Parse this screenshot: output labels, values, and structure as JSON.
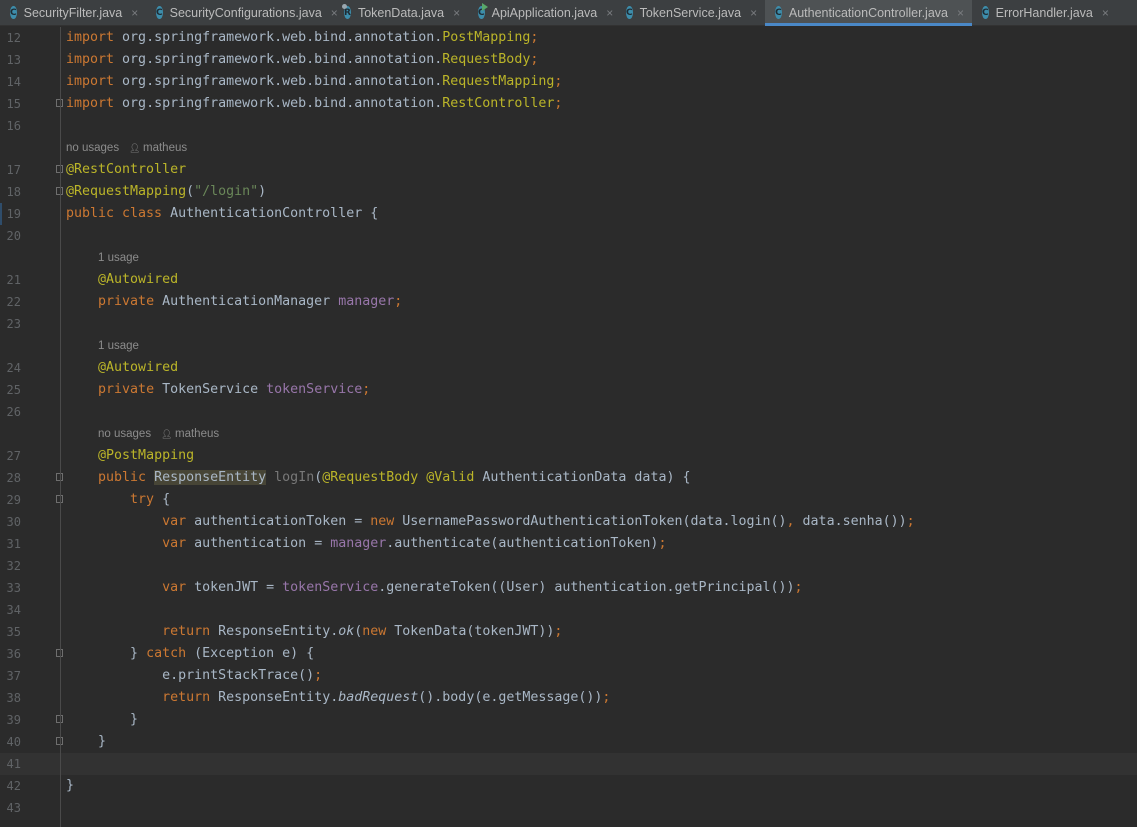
{
  "tabs": [
    {
      "label": "SecurityFilter.java",
      "icon": "class-icon",
      "glyph": "C",
      "active": false
    },
    {
      "label": "SecurityConfigurations.java",
      "icon": "class-icon",
      "glyph": "C",
      "active": false
    },
    {
      "label": "TokenData.java",
      "icon": "record-icon",
      "glyph": "R",
      "active": false
    },
    {
      "label": "ApiApplication.java",
      "icon": "runnable-class-icon",
      "glyph": "C",
      "active": false
    },
    {
      "label": "TokenService.java",
      "icon": "class-icon",
      "glyph": "C",
      "active": false
    },
    {
      "label": "AuthenticationController.java",
      "icon": "class-icon",
      "glyph": "C",
      "active": true
    },
    {
      "label": "ErrorHandler.java",
      "icon": "class-icon",
      "glyph": "C",
      "active": false
    }
  ],
  "close_glyph": "×",
  "colors": {
    "keyword": "#cc7832",
    "annotation": "#bbb529",
    "string": "#6a8759",
    "text": "#a9b7c6",
    "field": "#9876aa",
    "active_tab_underline": "#4a88c7"
  },
  "lines": [
    {
      "n": "12",
      "tokens": [
        [
          "k",
          "import "
        ],
        [
          "t",
          "org.springframework.web.bind.annotation."
        ],
        [
          "a",
          "PostMapping"
        ],
        [
          "k",
          ";"
        ]
      ]
    },
    {
      "n": "13",
      "tokens": [
        [
          "k",
          "import "
        ],
        [
          "t",
          "org.springframework.web.bind.annotation."
        ],
        [
          "a",
          "RequestBody"
        ],
        [
          "k",
          ";"
        ]
      ]
    },
    {
      "n": "14",
      "tokens": [
        [
          "k",
          "import "
        ],
        [
          "t",
          "org.springframework.web.bind.annotation."
        ],
        [
          "a",
          "RequestMapping"
        ],
        [
          "k",
          ";"
        ]
      ]
    },
    {
      "n": "15",
      "fold": true,
      "tokens": [
        [
          "k",
          "import "
        ],
        [
          "t",
          "org.springframework.web.bind.annotation."
        ],
        [
          "a",
          "RestController"
        ],
        [
          "k",
          ";"
        ]
      ]
    },
    {
      "n": "16",
      "tokens": []
    },
    {
      "hint": "no usages",
      "user": "matheus",
      "level": 0
    },
    {
      "n": "17",
      "fold": true,
      "tokens": [
        [
          "a",
          "@RestController"
        ]
      ]
    },
    {
      "n": "18",
      "fold": true,
      "tokens": [
        [
          "a",
          "@RequestMapping"
        ],
        [
          "t",
          "("
        ],
        [
          "s",
          "\"/login\""
        ],
        [
          "t",
          ")"
        ]
      ]
    },
    {
      "n": "19",
      "mark": true,
      "tokens": [
        [
          "k",
          "public class "
        ],
        [
          "t",
          "AuthenticationController {"
        ]
      ]
    },
    {
      "n": "20",
      "tokens": []
    },
    {
      "hint": "1 usage",
      "level": 1
    },
    {
      "n": "21",
      "tokens": [
        [
          "t",
          "    "
        ],
        [
          "a",
          "@Autowired"
        ]
      ]
    },
    {
      "n": "22",
      "tokens": [
        [
          "t",
          "    "
        ],
        [
          "k",
          "private "
        ],
        [
          "t",
          "AuthenticationManager "
        ],
        [
          "f",
          "manager"
        ],
        [
          "k",
          ";"
        ]
      ]
    },
    {
      "n": "23",
      "tokens": []
    },
    {
      "hint": "1 usage",
      "level": 1
    },
    {
      "n": "24",
      "tokens": [
        [
          "t",
          "    "
        ],
        [
          "a",
          "@Autowired"
        ]
      ]
    },
    {
      "n": "25",
      "tokens": [
        [
          "t",
          "    "
        ],
        [
          "k",
          "private "
        ],
        [
          "t",
          "TokenService "
        ],
        [
          "f",
          "tokenService"
        ],
        [
          "k",
          ";"
        ]
      ]
    },
    {
      "n": "26",
      "tokens": []
    },
    {
      "hint": "no usages",
      "user": "matheus",
      "level": 1
    },
    {
      "n": "27",
      "tokens": [
        [
          "t",
          "    "
        ],
        [
          "a",
          "@PostMapping"
        ]
      ]
    },
    {
      "n": "28",
      "fold": true,
      "tokens": [
        [
          "t",
          "    "
        ],
        [
          "k",
          "public "
        ],
        [
          "h",
          "ResponseEntity"
        ],
        [
          "t",
          " "
        ],
        [
          "u",
          "logIn"
        ],
        [
          "t",
          "("
        ],
        [
          "a",
          "@RequestBody @Valid "
        ],
        [
          "t",
          "AuthenticationData data) {"
        ]
      ]
    },
    {
      "n": "29",
      "fold": true,
      "tokens": [
        [
          "t",
          "        "
        ],
        [
          "k",
          "try "
        ],
        [
          "t",
          "{"
        ]
      ]
    },
    {
      "n": "30",
      "tokens": [
        [
          "t",
          "            "
        ],
        [
          "k",
          "var "
        ],
        [
          "t",
          "authenticationToken = "
        ],
        [
          "k",
          "new "
        ],
        [
          "t",
          "UsernamePasswordAuthenticationToken(data.login()"
        ],
        [
          "k",
          ", "
        ],
        [
          "t",
          "data.senha())"
        ],
        [
          "k",
          ";"
        ]
      ]
    },
    {
      "n": "31",
      "tokens": [
        [
          "t",
          "            "
        ],
        [
          "k",
          "var "
        ],
        [
          "t",
          "authentication = "
        ],
        [
          "f",
          "manager"
        ],
        [
          "t",
          ".authenticate(authenticationToken)"
        ],
        [
          "k",
          ";"
        ]
      ]
    },
    {
      "n": "32",
      "tokens": []
    },
    {
      "n": "33",
      "tokens": [
        [
          "t",
          "            "
        ],
        [
          "k",
          "var "
        ],
        [
          "t",
          "tokenJWT = "
        ],
        [
          "f",
          "tokenService"
        ],
        [
          "t",
          ".generateToken((User) authentication.getPrincipal())"
        ],
        [
          "k",
          ";"
        ]
      ]
    },
    {
      "n": "34",
      "tokens": []
    },
    {
      "n": "35",
      "tokens": [
        [
          "t",
          "            "
        ],
        [
          "k",
          "return "
        ],
        [
          "t",
          "ResponseEntity."
        ],
        [
          "i",
          "ok"
        ],
        [
          "t",
          "("
        ],
        [
          "k",
          "new "
        ],
        [
          "t",
          "TokenData(tokenJWT))"
        ],
        [
          "k",
          ";"
        ]
      ]
    },
    {
      "n": "36",
      "fold": true,
      "tokens": [
        [
          "t",
          "        } "
        ],
        [
          "k",
          "catch "
        ],
        [
          "t",
          "(Exception e) {"
        ]
      ]
    },
    {
      "n": "37",
      "tokens": [
        [
          "t",
          "            e.printStackTrace()"
        ],
        [
          "k",
          ";"
        ]
      ]
    },
    {
      "n": "38",
      "tokens": [
        [
          "t",
          "            "
        ],
        [
          "k",
          "return "
        ],
        [
          "t",
          "ResponseEntity."
        ],
        [
          "i",
          "badRequest"
        ],
        [
          "t",
          "().body(e.getMessage())"
        ],
        [
          "k",
          ";"
        ]
      ]
    },
    {
      "n": "39",
      "fold": true,
      "tokens": [
        [
          "t",
          "        }"
        ]
      ]
    },
    {
      "n": "40",
      "fold": true,
      "tokens": [
        [
          "t",
          "    }"
        ]
      ]
    },
    {
      "n": "41",
      "current": true,
      "tokens": []
    },
    {
      "n": "42",
      "tokens": [
        [
          "t",
          "}"
        ]
      ]
    },
    {
      "n": "43",
      "tokens": []
    }
  ]
}
